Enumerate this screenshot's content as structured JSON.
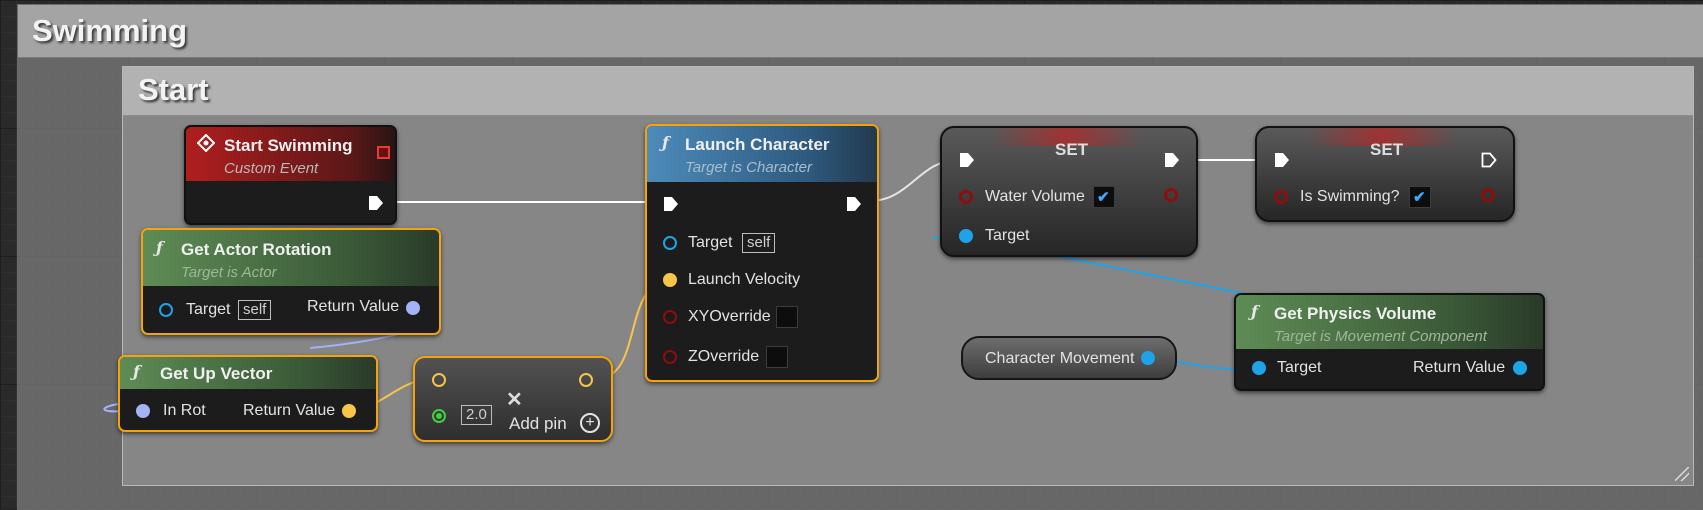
{
  "comments": {
    "outer": "Swimming",
    "inner": "Start"
  },
  "nodes": {
    "start_swimming": {
      "title": "Start Swimming",
      "subtitle": "Custom Event"
    },
    "get_actor_rotation": {
      "title": "Get Actor Rotation",
      "subtitle": "Target is Actor",
      "target": "Target",
      "target_default": "self",
      "return": "Return Value"
    },
    "get_up_vector": {
      "title": "Get Up Vector",
      "in": "In Rot",
      "return": "Return Value"
    },
    "multiply": {
      "value": "2.0",
      "add_pin": "Add pin"
    },
    "launch_character": {
      "title": "Launch Character",
      "subtitle": "Target is Character",
      "target": "Target",
      "target_default": "self",
      "velocity": "Launch Velocity",
      "xy": "XYOverride",
      "z": "ZOverride"
    },
    "set_water": {
      "title": "SET",
      "var": "Water Volume",
      "target": "Target"
    },
    "set_swimming": {
      "title": "SET",
      "var": "Is Swimming?"
    },
    "character_movement": {
      "label": "Character Movement"
    },
    "get_physics_volume": {
      "title": "Get Physics Volume",
      "subtitle": "Target is Movement Component",
      "target": "Target",
      "return": "Return Value"
    }
  },
  "colors": {
    "selection": "#f4a30c",
    "exec": "#ffffff",
    "object_pin": "#1fa3e8",
    "vector_pin": "#f6c54a",
    "rotator_pin": "#a3b3f5",
    "bool_pin": "#8e0e0e",
    "float_pin": "#3fcf3f",
    "event_header": "#a21d1d",
    "function_header": "#4f7a4a",
    "target_function_header": "#3a6d92"
  },
  "icons": {
    "function": "function-icon",
    "event": "event-icon",
    "remove": "remove-pin-icon",
    "add": "add-pin-icon"
  }
}
